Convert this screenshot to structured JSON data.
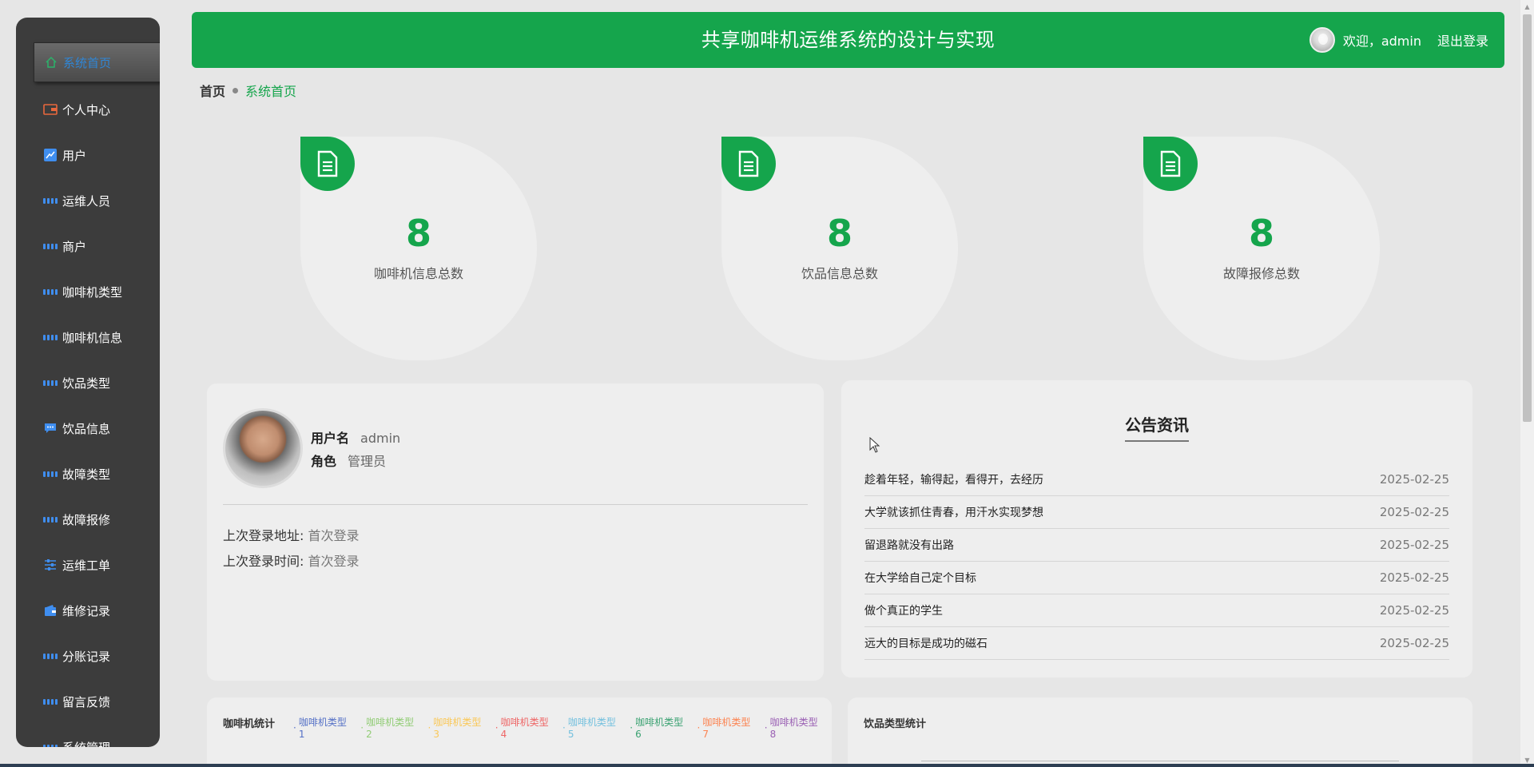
{
  "header": {
    "title": "共享咖啡机运维系统的设计与实现",
    "welcome": "欢迎，admin",
    "logout": "退出登录"
  },
  "sidebar": {
    "items": [
      {
        "label": "系统首页",
        "icon": "home-icon"
      },
      {
        "label": "个人中心",
        "icon": "wallet-icon"
      },
      {
        "label": "用户",
        "icon": "chart-icon"
      },
      {
        "label": "运维人员",
        "icon": "grid-icon"
      },
      {
        "label": "商户",
        "icon": "grid-icon"
      },
      {
        "label": "咖啡机类型",
        "icon": "grid-icon"
      },
      {
        "label": "咖啡机信息",
        "icon": "grid-icon"
      },
      {
        "label": "饮品类型",
        "icon": "grid-icon"
      },
      {
        "label": "饮品信息",
        "icon": "message-icon"
      },
      {
        "label": "故障类型",
        "icon": "grid-icon"
      },
      {
        "label": "故障报修",
        "icon": "grid-icon"
      },
      {
        "label": "运维工单",
        "icon": "sliders-icon"
      },
      {
        "label": "维修记录",
        "icon": "wallet-icon"
      },
      {
        "label": "分账记录",
        "icon": "grid-icon"
      },
      {
        "label": "留言反馈",
        "icon": "grid-icon"
      },
      {
        "label": "系统管理",
        "icon": "grid-icon"
      }
    ]
  },
  "breadcrumb": {
    "home": "首页",
    "current": "系统首页"
  },
  "stats": [
    {
      "value": "8",
      "label": "咖啡机信息总数"
    },
    {
      "value": "8",
      "label": "饮品信息总数"
    },
    {
      "value": "8",
      "label": "故障报修总数"
    }
  ],
  "profile": {
    "username_label": "用户名",
    "username": "admin",
    "role_label": "角色",
    "role": "管理员",
    "last_addr_label": "上次登录地址:",
    "last_addr": "首次登录",
    "last_time_label": "上次登录时间:",
    "last_time": "首次登录"
  },
  "notice": {
    "title": "公告资讯",
    "items": [
      {
        "title": "趁着年轻，输得起，看得开，去经历",
        "date": "2025-02-25"
      },
      {
        "title": "大学就该抓住青春，用汗水实现梦想",
        "date": "2025-02-25"
      },
      {
        "title": "留退路就没有出路",
        "date": "2025-02-25"
      },
      {
        "title": "在大学给自己定个目标",
        "date": "2025-02-25"
      },
      {
        "title": "做个真正的学生",
        "date": "2025-02-25"
      },
      {
        "title": "远大的目标是成功的磁石",
        "date": "2025-02-25"
      }
    ]
  },
  "coffee_stats": {
    "title": "咖啡机统计",
    "legend": [
      {
        "label": "咖啡机类型1",
        "color": "#5470c6"
      },
      {
        "label": "咖啡机类型2",
        "color": "#91cc75"
      },
      {
        "label": "咖啡机类型3",
        "color": "#fac858"
      },
      {
        "label": "咖啡机类型4",
        "color": "#ee6666"
      },
      {
        "label": "咖啡机类型5",
        "color": "#73c0de"
      },
      {
        "label": "咖啡机类型6",
        "color": "#3ba272"
      },
      {
        "label": "咖啡机类型7",
        "color": "#fc8452"
      },
      {
        "label": "咖啡机类型8",
        "color": "#9a60b4"
      }
    ]
  },
  "drink_stats": {
    "title": "饮品类型统计"
  },
  "colors": {
    "brand": "#15a54c",
    "sidebar": "#3c3c3c",
    "link_blue": "#3f8ef0",
    "background": "#e6e6e6"
  }
}
